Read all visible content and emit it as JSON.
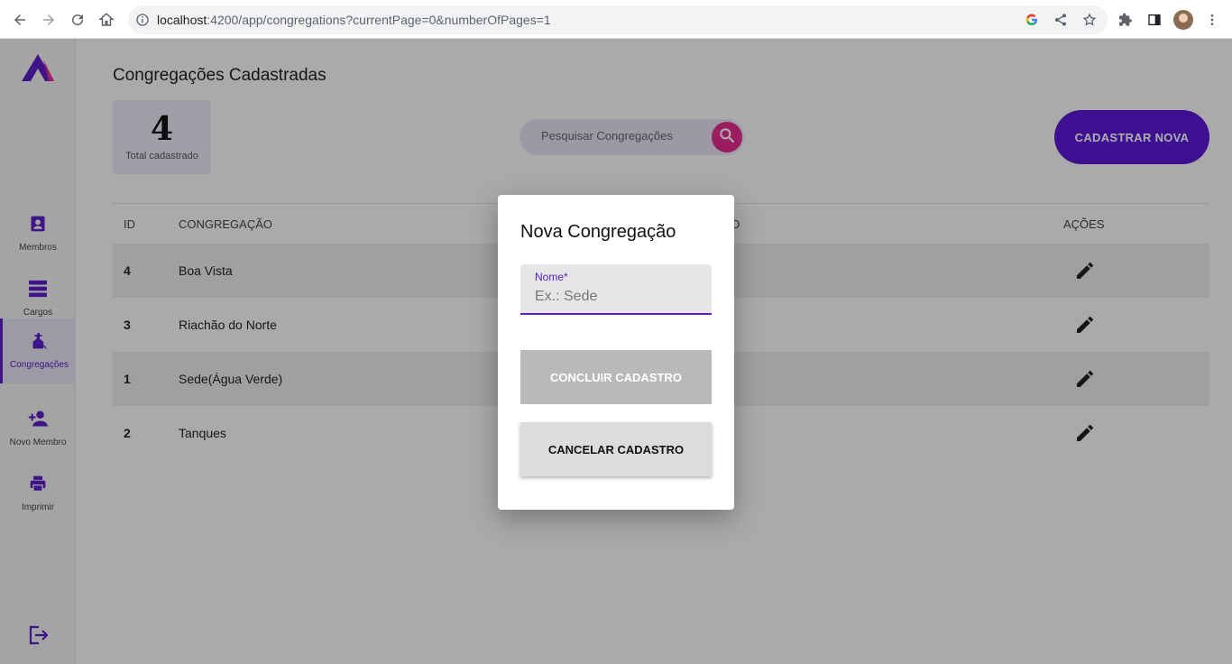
{
  "browser": {
    "url_host": "localhost",
    "url_rest": ":4200/app/congregations?currentPage=0&numberOfPages=1"
  },
  "sidebar": {
    "items": [
      {
        "label": "Membros",
        "icon": "badge-icon"
      },
      {
        "label": "Cargos",
        "icon": "list-icon"
      },
      {
        "label": "Congregações",
        "icon": "church-icon",
        "active": true
      },
      {
        "label": "Novo Membro",
        "icon": "person-add-icon"
      },
      {
        "label": "Imprimir",
        "icon": "print-icon"
      }
    ],
    "logout_icon": "logout-icon"
  },
  "main": {
    "title": "Congregações Cadastradas",
    "total": {
      "value": "4",
      "label": "Total cadastrado"
    },
    "search_placeholder": "Pesquisar Congregações",
    "cta_label": "CADASTRAR NOVA",
    "table": {
      "headers": {
        "id": "ID",
        "name": "CONGREGAÇÃO",
        "extra": "D",
        "actions": "AÇÕES"
      },
      "rows": [
        {
          "id": "4",
          "name": "Boa Vista"
        },
        {
          "id": "3",
          "name": "Riachão do Norte"
        },
        {
          "id": "1",
          "name": "Sede(Água Verde)"
        },
        {
          "id": "2",
          "name": "Tanques"
        }
      ]
    }
  },
  "dialog": {
    "title": "Nova Congregação",
    "field_label": "Nome*",
    "field_placeholder": "Ex.: Sede",
    "confirm_label": "CONCLUIR CADASTRO",
    "cancel_label": "CANCELAR CADASTRO"
  },
  "colors": {
    "accent": "#5a19d6",
    "search_button": "#e22c8e"
  }
}
